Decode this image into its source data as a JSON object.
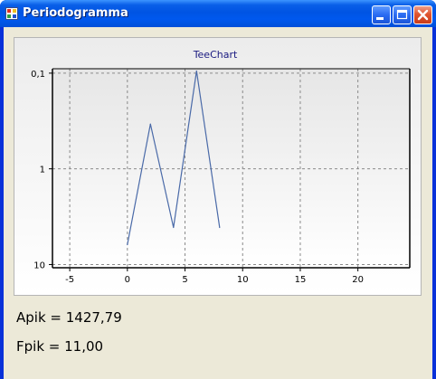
{
  "window": {
    "title": "Periodogramma"
  },
  "titlebar_buttons": {
    "minimize_icon": "minimize-icon",
    "maximize_icon": "maximize-icon",
    "close_icon": "close-icon"
  },
  "chart_data": {
    "type": "line",
    "title": "TeeChart",
    "xlabel": "",
    "ylabel": "",
    "xlim": [
      -6.5,
      24.5
    ],
    "ylim": [
      0.09,
      10.8
    ],
    "y_scale": "log",
    "y_inverted": true,
    "x_ticks": [
      "-5",
      "0",
      "5",
      "10",
      "15",
      "20"
    ],
    "y_ticks": [
      "0,1",
      "1",
      "10"
    ],
    "grid": true,
    "line_color": "#4a6aa8",
    "series": [
      {
        "x": [
          0,
          2,
          4,
          6,
          8
        ],
        "y": [
          6.2,
          0.34,
          4.1,
          0.095,
          4.1
        ]
      }
    ]
  },
  "results": {
    "apik": "Apik = 1427,79",
    "fpik": "Fpik = 11,00"
  }
}
